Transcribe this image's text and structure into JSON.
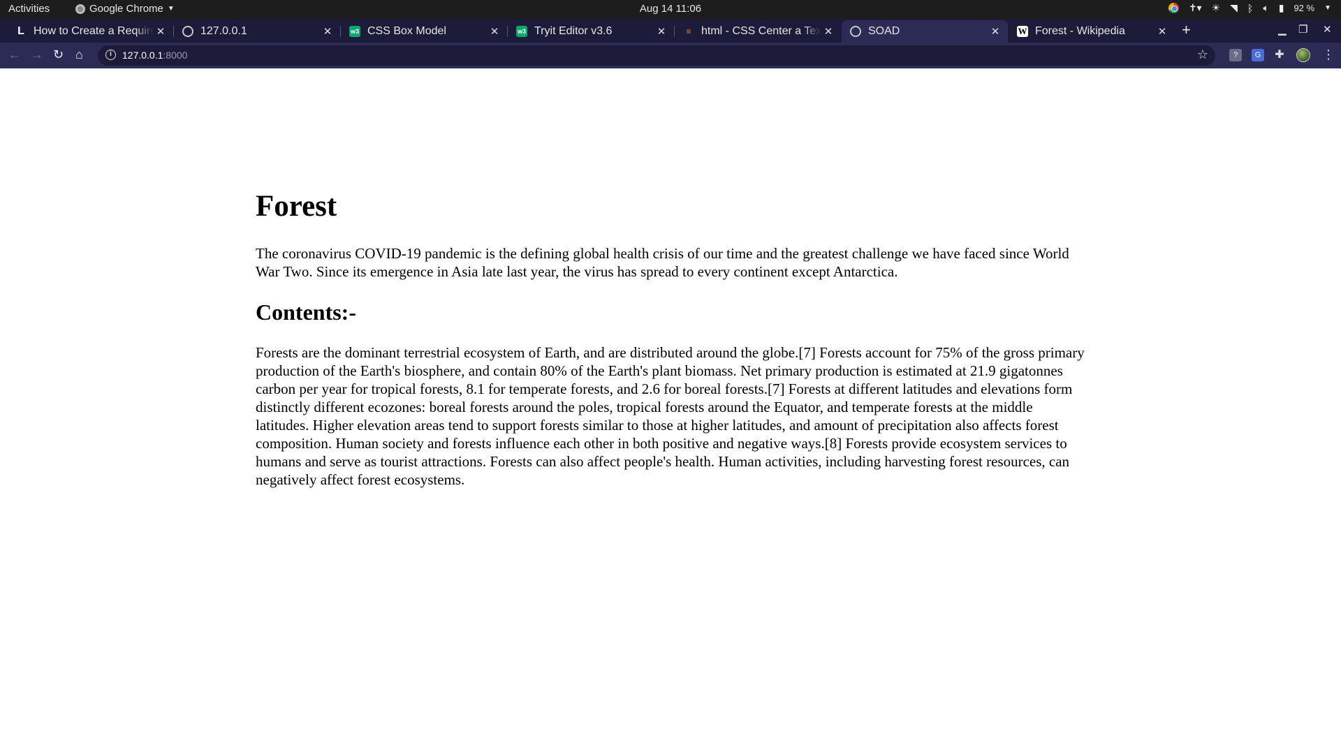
{
  "system_bar": {
    "activities": "Activities",
    "app_name": "Google Chrome",
    "clock": "Aug 14  11:06",
    "battery": "92 %"
  },
  "tabs": [
    {
      "title": "How to Create a Required",
      "favicon": "L",
      "active": false
    },
    {
      "title": "127.0.0.1",
      "favicon": "globe-icon",
      "active": false
    },
    {
      "title": "CSS Box Model",
      "favicon": "w3",
      "active": false
    },
    {
      "title": "Tryit Editor v3.6",
      "favicon": "w3",
      "active": false
    },
    {
      "title": "html - CSS Center a Text",
      "favicon": "stackoverflow-icon",
      "active": false
    },
    {
      "title": "SOAD",
      "favicon": "globe-icon",
      "active": true
    },
    {
      "title": "Forest - Wikipedia",
      "favicon": "W",
      "active": false
    }
  ],
  "omnibox": {
    "host": "127.0.0.1",
    "port": ":8000"
  },
  "page": {
    "title": "Forest",
    "intro": "The coronavirus COVID-19 pandemic is the defining global health crisis of our time and the greatest challenge we have faced since World War Two. Since its emergence in Asia late last year, the virus has spread to every continent except Antarctica.",
    "contents_heading": "Contents:-",
    "body": "Forests are the dominant terrestrial ecosystem of Earth, and are distributed around the globe.[7] Forests account for 75% of the gross primary production of the Earth's biosphere, and contain 80% of the Earth's plant biomass. Net primary production is estimated at 21.9 gigatonnes carbon per year for tropical forests, 8.1 for temperate forests, and 2.6 for boreal forests.[7] Forests at different latitudes and elevations form distinctly different ecozones: boreal forests around the poles, tropical forests around the Equator, and temperate forests at the middle latitudes. Higher elevation areas tend to support forests similar to those at higher latitudes, and amount of precipitation also affects forest composition. Human society and forests influence each other in both positive and negative ways.[8] Forests provide ecosystem services to humans and serve as tourist attractions. Forests can also affect people's health. Human activities, including harvesting forest resources, can negatively affect forest ecosystems."
  },
  "colors": {
    "tabstrip": "#1c1c3a",
    "toolbar": "#2b2b55",
    "system_bar": "#1d1d1d"
  }
}
